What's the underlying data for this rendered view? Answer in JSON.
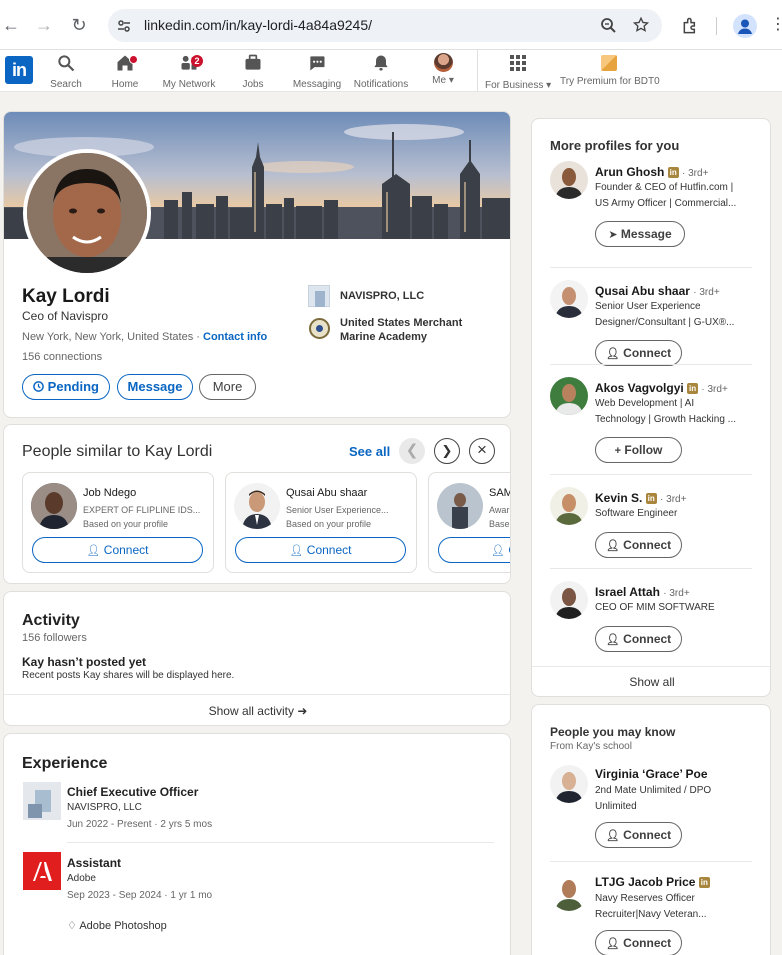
{
  "browser": {
    "url": "linkedin.com/in/kay-lordi-4a84a9245/"
  },
  "nav": {
    "items": [
      {
        "label": "Search"
      },
      {
        "label": "Home"
      },
      {
        "label": "My Network",
        "badge": "2"
      },
      {
        "label": "Jobs"
      },
      {
        "label": "Messaging"
      },
      {
        "label": "Notifications"
      },
      {
        "label": "Me"
      },
      {
        "label": "For Business"
      },
      {
        "label": "Try Premium for BDT0"
      }
    ]
  },
  "profile": {
    "name": "Kay Lordi",
    "headline": "Ceo of Navispro",
    "location": "New York, New York, United States",
    "contact_link": "Contact info",
    "connections": "156 connections",
    "buttons": {
      "pending": "Pending",
      "message": "Message",
      "more": "More"
    },
    "companies": [
      {
        "name": "NAVISPRO, LLC"
      },
      {
        "name": "United States Merchant Marine Academy"
      }
    ]
  },
  "similar": {
    "title": "People similar to Kay Lordi",
    "see_all": "See all",
    "cards": [
      {
        "name": "Job Ndego",
        "headline": "EXPERT OF FLIPLINE IDS...",
        "reason": "Based on your profile",
        "action": "Connect"
      },
      {
        "name": "Qusai Abu shaar",
        "headline": "Senior User Experience...",
        "reason": "Based on your profile",
        "action": "Connect"
      },
      {
        "name": "SAM",
        "headline": "Awar",
        "reason": "Base",
        "action": "C"
      }
    ]
  },
  "activity": {
    "title": "Activity",
    "followers": "156 followers",
    "empty_title": "Kay hasn’t posted yet",
    "empty_sub": "Recent posts Kay shares will be displayed here.",
    "show_all": "Show all activity"
  },
  "experience": {
    "title": "Experience",
    "items": [
      {
        "title": "Chief Executive Officer",
        "company": "NAVISPRO, LLC",
        "dates": "Jun 2022 - Present · 2 yrs 5 mos"
      },
      {
        "title": "Assistant",
        "company": "Adobe",
        "dates": "Sep 2023 - Sep 2024 · 1 yr 1 mo",
        "skill": "Adobe Photoshop"
      }
    ]
  },
  "more_profiles": {
    "title": "More profiles for you",
    "show_all": "Show all",
    "items": [
      {
        "name": "Arun Ghosh",
        "degree": "3rd+",
        "line1": "Founder & CEO of Hutfin.com |",
        "line2": "US Army Officer | Commercial...",
        "action": "Message"
      },
      {
        "name": "Qusai Abu shaar",
        "degree": "3rd+",
        "line1": "Senior User Experience",
        "line2": "Designer/Consultant | G-UX®...",
        "action": "Connect"
      },
      {
        "name": "Akos Vagvolgyi",
        "degree": "3rd+",
        "line1": "Web Development | AI",
        "line2": "Technology | Growth Hacking ...",
        "action": "Follow"
      },
      {
        "name": "Kevin S.",
        "degree": "3rd+",
        "line1": "Software Engineer",
        "line2": "",
        "action": "Connect"
      },
      {
        "name": "Israel Attah",
        "degree": "3rd+",
        "line1": "CEO OF MIM SOFTWARE",
        "line2": "",
        "action": "Connect"
      }
    ]
  },
  "people_know": {
    "title": "People you may know",
    "subtitle": "From Kay's school",
    "items": [
      {
        "name": "Virginia ‘Grace’ Poe",
        "line1": "2nd Mate Unlimited / DPO",
        "line2": "Unlimited",
        "action": "Connect"
      },
      {
        "name": "LTJG Jacob Price",
        "line1": "Navy Reserves Officer",
        "line2": "Recruiter|Navy Veteran...",
        "action": "Connect"
      }
    ]
  },
  "colors": {
    "brand": "#0a66c2",
    "page_bg": "#f4f2ee",
    "notification": "#cb112d",
    "premium_badge": "#a8863d"
  }
}
